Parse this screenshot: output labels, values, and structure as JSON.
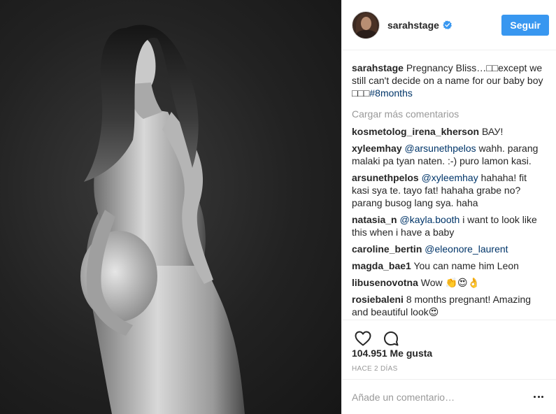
{
  "photo": {
    "description_icon": "portrait-photo"
  },
  "header": {
    "username": "sarahstage",
    "verified_icon": "verified-badge-icon",
    "follow_label": "Seguir"
  },
  "caption": {
    "username": "sarahstage",
    "text": "Pregnancy Bliss…□□except we still can't decide on a name for our baby boy □□□",
    "hashtag": "#8months"
  },
  "load_more_label": "Cargar más comentarios",
  "comments": [
    {
      "user": "kosmetolog_irena_kherson",
      "mention": "",
      "text": "ВАУ!"
    },
    {
      "user": "xyleemhay",
      "mention": "@arsunethpelos",
      "text": "wahh. parang malaki pa tyan naten. :-) puro lamon kasi."
    },
    {
      "user": "arsunethpelos",
      "mention": "@xyleemhay",
      "text": "hahaha! fit kasi sya te. tayo fat! hahaha grabe no? parang busog lang sya. haha"
    },
    {
      "user": "natasia_n",
      "mention": "@kayla.booth",
      "text": "i want to look like this when i have a baby"
    },
    {
      "user": "caroline_bertin",
      "mention": "@eleonore_laurent",
      "text": ""
    },
    {
      "user": "magda_bae1",
      "mention": "",
      "text": "You can name him Leon"
    },
    {
      "user": "libusenovotna",
      "mention": "",
      "text": "Wow 👏😍👌"
    },
    {
      "user": "rosiebaleni",
      "mention": "",
      "text": "8 months pregnant! Amazing and beautiful look😍"
    }
  ],
  "actions": {
    "like_icon": "heart-outline-icon",
    "comment_icon": "comment-bubble-icon"
  },
  "likes_label": "104.951 Me gusta",
  "time_label": "HACE 2 DÍAS",
  "add_comment": {
    "placeholder": "Añade un comentario…",
    "more_icon": "more-options-icon"
  },
  "colors": {
    "accent": "#3897f0",
    "mention": "#003569",
    "muted": "#999999",
    "text": "#262626",
    "border": "#efefef"
  }
}
